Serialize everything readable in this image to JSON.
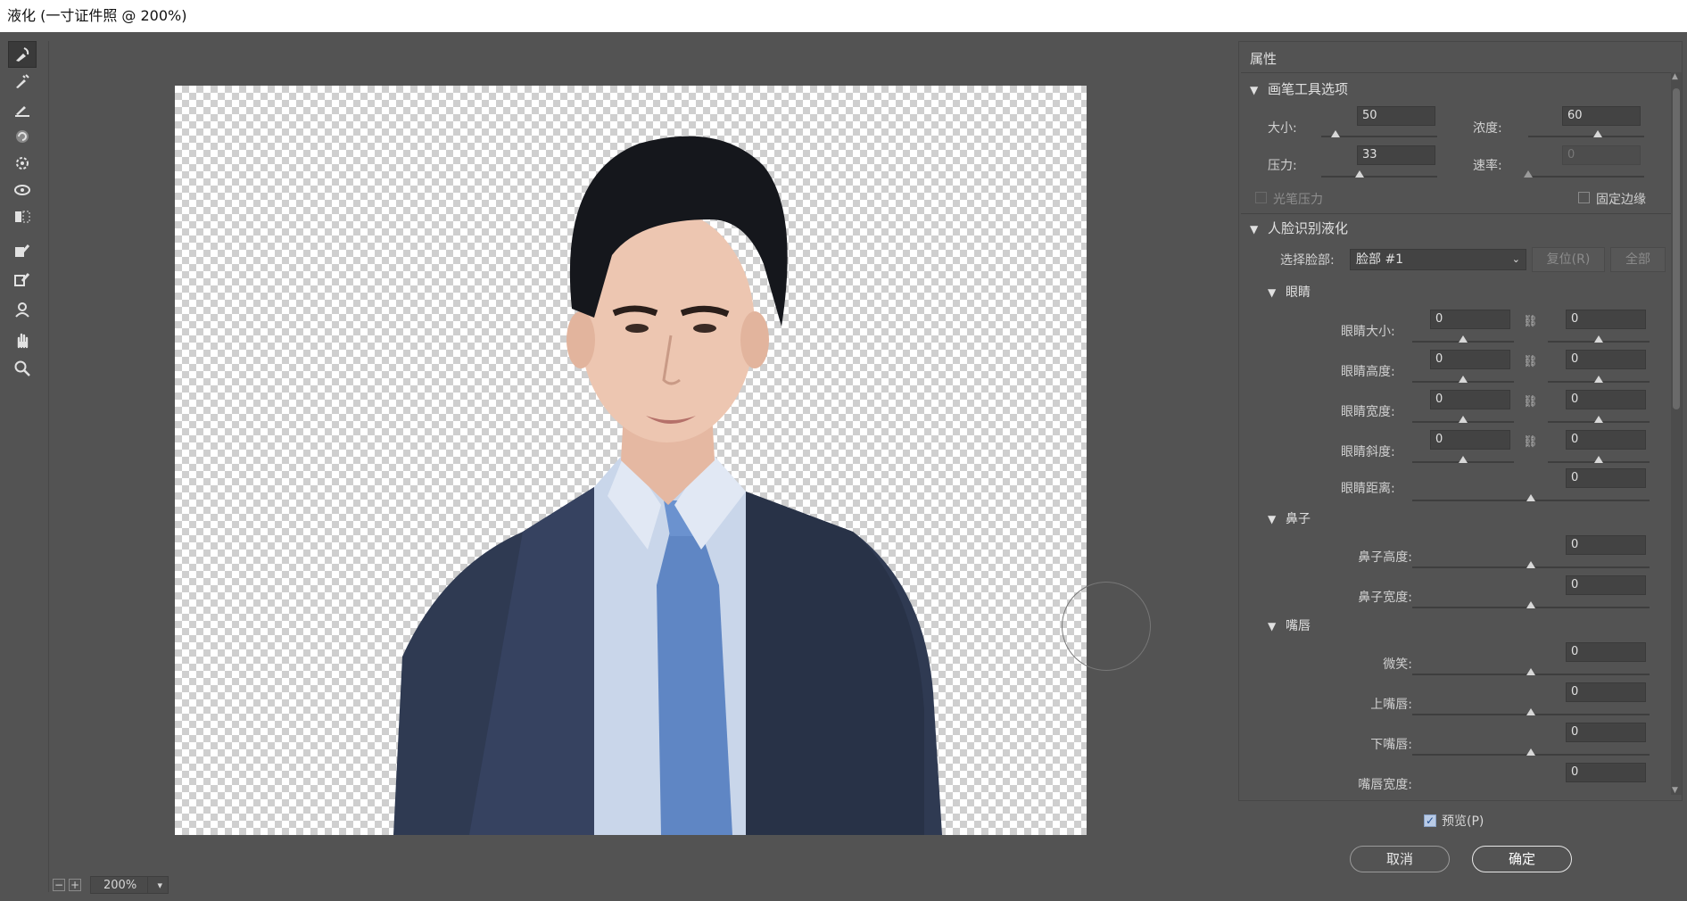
{
  "window": {
    "title": "液化 (一寸证件照 @ 200%)"
  },
  "zoom": {
    "value": "200%",
    "zoom_out": "−",
    "zoom_in": "+"
  },
  "panel": {
    "title": "属性",
    "brush_section": "画笔工具选项",
    "brush": {
      "size_label": "大小:",
      "size_value": "50",
      "size_pct": 0.12,
      "density_label": "浓度:",
      "density_value": "60",
      "density_pct": 0.6,
      "pressure_label": "压力:",
      "pressure_value": "33",
      "pressure_pct": 0.33,
      "rate_label": "速率:",
      "rate_value": "0",
      "rate_pct": 0.0,
      "stylus_label": "光笔压力",
      "pin_edges_label": "固定边缘"
    },
    "face_section": "人脸识别液化",
    "face_select_label": "选择脸部:",
    "face_select_value": "脸部 #1",
    "reset_label": "复位(R)",
    "all_label": "全部",
    "eyes": {
      "title": "眼睛",
      "rows": [
        {
          "label": "眼睛大小:",
          "left": "0",
          "right": "0"
        },
        {
          "label": "眼睛高度:",
          "left": "0",
          "right": "0"
        },
        {
          "label": "眼睛宽度:",
          "left": "0",
          "right": "0"
        },
        {
          "label": "眼睛斜度:",
          "left": "0",
          "right": "0"
        }
      ],
      "distance_label": "眼睛距离:",
      "distance_value": "0"
    },
    "nose": {
      "title": "鼻子",
      "rows": [
        {
          "label": "鼻子高度:",
          "value": "0"
        },
        {
          "label": "鼻子宽度:",
          "value": "0"
        }
      ]
    },
    "mouth": {
      "title": "嘴唇",
      "rows": [
        {
          "label": "微笑:",
          "value": "0"
        },
        {
          "label": "上嘴唇:",
          "value": "0"
        },
        {
          "label": "下嘴唇:",
          "value": "0"
        },
        {
          "label": "嘴唇宽度:",
          "value": "0"
        }
      ]
    }
  },
  "footer": {
    "preview_label": "预览(P)",
    "preview_checked": true,
    "cancel_label": "取消",
    "ok_label": "确定"
  },
  "tools": [
    "forward-warp-tool",
    "reconstruct-tool",
    "smooth-tool",
    "twirl-tool",
    "pucker-tool",
    "bloat-tool",
    "push-left-tool",
    "freeze-mask-tool",
    "thaw-mask-tool",
    "face-tool",
    "hand-tool",
    "zoom-tool"
  ],
  "colors": {
    "workspace": "#535353",
    "title_bar": "#ffffff",
    "checker": "#cfcfcf"
  }
}
